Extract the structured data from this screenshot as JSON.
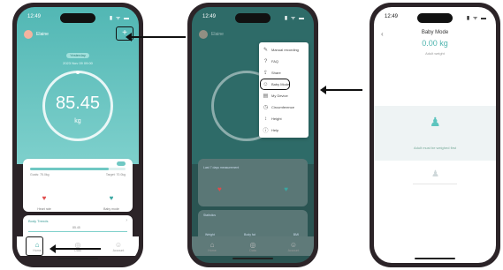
{
  "phone1": {
    "status_time": "12:49",
    "status_icons": "▮ ᯤ ▬",
    "user_name": "Elaine",
    "plus_label": "+",
    "date_pill": "Yesterday",
    "date_text": "2023 Nov 09 09:00",
    "weight_value": "85.45",
    "weight_unit": "kg",
    "bar_left_label": "Goals: 75.0kg",
    "bar_right_label": "Target: 70.0kg",
    "progress_fraction": 0.82,
    "icon1_label": "Heart rate",
    "icon2_label": "Baby mode",
    "trend_title": "Body Trends",
    "trend_value": "85.45",
    "tabs": [
      {
        "icon": "⌂",
        "label": "Home"
      },
      {
        "icon": "◎",
        "label": "Data"
      },
      {
        "icon": "☺",
        "label": "Account"
      }
    ]
  },
  "phone2": {
    "status_time": "12:49",
    "status_icons": "▮ ᯤ ▬",
    "user_name": "Elaine",
    "menu": [
      {
        "icon": "✎",
        "label": "Manual recording"
      },
      {
        "icon": "?",
        "label": "FAQ"
      },
      {
        "icon": "⇪",
        "label": "Share"
      },
      {
        "icon": "☺",
        "label": "Baby Mode"
      },
      {
        "icon": "▤",
        "label": "My Device"
      },
      {
        "icon": "◷",
        "label": "Circumference"
      },
      {
        "icon": "↕",
        "label": "Height"
      },
      {
        "icon": "ⓘ",
        "label": "Help"
      }
    ],
    "card_label": "Last 7 days measurement",
    "stats_title": "Statistics",
    "stats_cols": [
      "Weight",
      "Body fat",
      "BMI"
    ],
    "tabs": [
      {
        "icon": "⌂",
        "label": "Home"
      },
      {
        "icon": "◎",
        "label": "Data"
      },
      {
        "icon": "☺",
        "label": "Account"
      }
    ]
  },
  "phone3": {
    "status_time": "12:49",
    "status_icons": "▮ ᯤ ▬",
    "title": "Baby Mode",
    "weight_value": "0.00 kg",
    "sub_label": "Adult weight",
    "message": "Adult must be weighed first"
  },
  "colors": {
    "teal": "#52b7b4",
    "teal_light": "#7ed0cc",
    "dim_overlay": "#2a5452",
    "arrow": "#111111"
  }
}
